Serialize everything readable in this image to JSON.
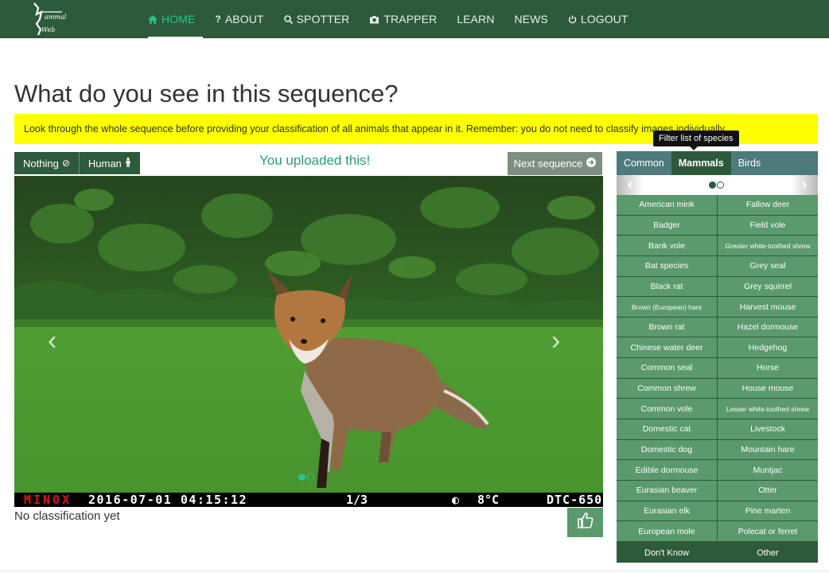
{
  "brand": {
    "logo_text": "Mammal Web"
  },
  "nav": [
    {
      "label": "HOME",
      "icon": "home-icon",
      "active": true
    },
    {
      "label": "ABOUT",
      "icon": "question-icon",
      "active": false
    },
    {
      "label": "SPOTTER",
      "icon": "search-icon",
      "active": false
    },
    {
      "label": "TRAPPER",
      "icon": "camera-icon",
      "active": false
    },
    {
      "label": "LEARN",
      "icon": "",
      "active": false
    },
    {
      "label": "NEWS",
      "icon": "",
      "active": false
    },
    {
      "label": "LOGOUT",
      "icon": "power-icon",
      "active": false
    }
  ],
  "page": {
    "title": "What do you see in this sequence?",
    "alert": "Look through the whole sequence before providing your classification of all animals that appear in it. Remember: you do not need to classify images individually."
  },
  "controls": {
    "nothing_label": "Nothing",
    "human_label": "Human",
    "uploaded_text": "You uploaded this!",
    "next_label": "Next sequence"
  },
  "photo": {
    "stamp_brand": "MINOX",
    "stamp_datetime": "2016-07-01  04:15:12",
    "stamp_frame": "1/3",
    "stamp_temp": "8°C",
    "stamp_model": "DTC-650",
    "slide_count": 2,
    "active_slide": 1
  },
  "status": {
    "classification": "No classification yet"
  },
  "species_panel": {
    "tooltip": "Filter list of species",
    "tabs": [
      {
        "label": "Common",
        "active": false
      },
      {
        "label": "Mammals",
        "active": true
      },
      {
        "label": "Birds",
        "active": false
      }
    ],
    "page_count": 2,
    "active_page": 1,
    "species": [
      [
        "American mink",
        "Fallow deer"
      ],
      [
        "Badger",
        "Field vole"
      ],
      [
        "Bank vole",
        "Greater white-toothed shrew"
      ],
      [
        "Bat species",
        "Grey seal"
      ],
      [
        "Black rat",
        "Grey squirrel"
      ],
      [
        "Brown (European) hare",
        "Harvest mouse"
      ],
      [
        "Brown rat",
        "Hazel dormouse"
      ],
      [
        "Chinese water deer",
        "Hedgehog"
      ],
      [
        "Common seal",
        "Horse"
      ],
      [
        "Common shrew",
        "House mouse"
      ],
      [
        "Common vole",
        "Lesser white-toothed shrew"
      ],
      [
        "Domestic cat",
        "Livestock"
      ],
      [
        "Domestic dog",
        "Mountain hare"
      ],
      [
        "Edible dormouse",
        "Muntjac"
      ],
      [
        "Eurasian beaver",
        "Otter"
      ],
      [
        "Eurasian elk",
        "Pine marten"
      ],
      [
        "European mole",
        "Polecat or ferret"
      ]
    ],
    "dont_know_label": "Don't Know",
    "other_label": "Other"
  }
}
